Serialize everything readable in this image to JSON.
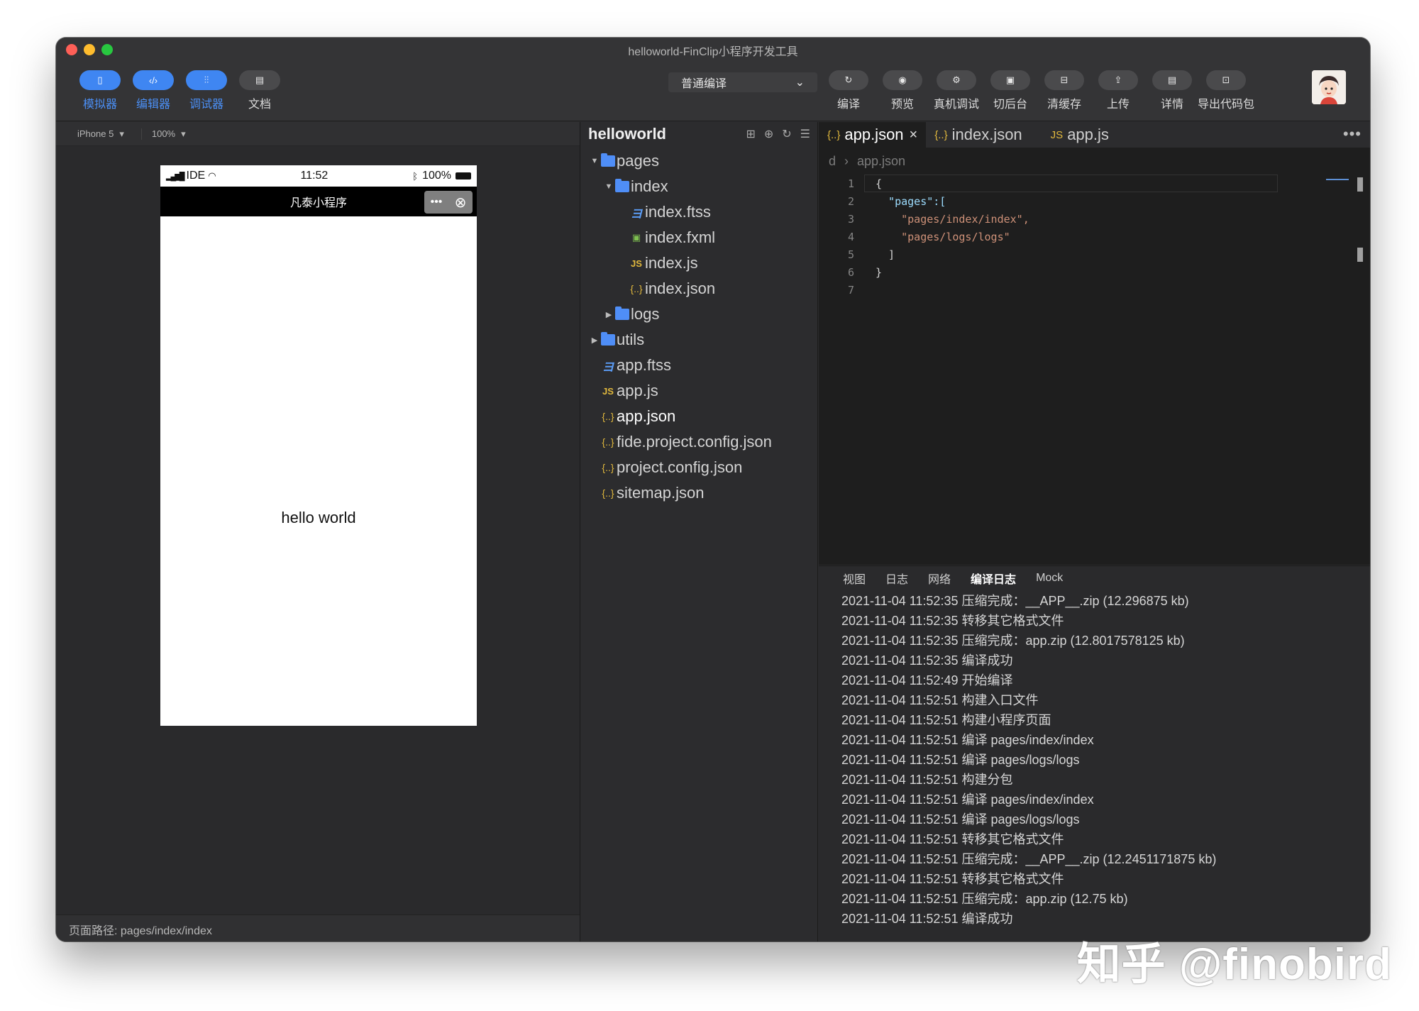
{
  "window": {
    "title": "helloworld-FinClip小程序开发工具"
  },
  "toolbar": {
    "left": [
      {
        "icon": "phone-icon",
        "glyph": "▯",
        "label": "模拟器",
        "active": true
      },
      {
        "icon": "code-icon",
        "glyph": "‹/›",
        "label": "编辑器",
        "active": true
      },
      {
        "icon": "sliders-icon",
        "glyph": "⫶⫶",
        "label": "调试器",
        "active": true
      },
      {
        "icon": "document-icon",
        "glyph": "▤",
        "label": "文档",
        "active": false
      }
    ],
    "compile_mode": "普通编译",
    "right": [
      {
        "icon": "refresh-icon",
        "glyph": "↻",
        "label": "编译"
      },
      {
        "icon": "eye-icon",
        "glyph": "◉",
        "label": "预览"
      },
      {
        "icon": "device-debug-icon",
        "glyph": "⚙",
        "label": "真机调试"
      },
      {
        "icon": "background-icon",
        "glyph": "▣",
        "label": "切后台"
      },
      {
        "icon": "clear-cache-icon",
        "glyph": "⊟",
        "label": "清缓存"
      },
      {
        "icon": "upload-icon",
        "glyph": "⇪",
        "label": "上传"
      },
      {
        "icon": "details-icon",
        "glyph": "▤",
        "label": "详情"
      },
      {
        "icon": "folder-export-icon",
        "glyph": "⊡",
        "label": "导出代码包"
      }
    ]
  },
  "simulator": {
    "device": "iPhone 5",
    "zoom": "100%",
    "status": {
      "carrier": "IDE",
      "time": "11:52",
      "battery": "100%"
    },
    "nav_title": "凡泰小程序",
    "capsule_more": "•••",
    "capsule_close": "⊗",
    "content": "hello world",
    "footer_path": "页面路径: pages/index/index"
  },
  "tree": {
    "title": "helloworld",
    "items": [
      {
        "name": "pages",
        "type": "folder",
        "depth": 0,
        "expanded": true
      },
      {
        "name": "index",
        "type": "folder",
        "depth": 1,
        "expanded": true
      },
      {
        "name": "index.ftss",
        "type": "ftss",
        "depth": 2
      },
      {
        "name": "index.fxml",
        "type": "fxml",
        "depth": 2
      },
      {
        "name": "index.js",
        "type": "js",
        "depth": 2
      },
      {
        "name": "index.json",
        "type": "json",
        "depth": 2
      },
      {
        "name": "logs",
        "type": "folder",
        "depth": 1,
        "expanded": false
      },
      {
        "name": "utils",
        "type": "folder",
        "depth": 0,
        "expanded": false
      },
      {
        "name": "app.ftss",
        "type": "ftss",
        "depth": 0
      },
      {
        "name": "app.js",
        "type": "js",
        "depth": 0
      },
      {
        "name": "app.json",
        "type": "json",
        "depth": 0,
        "selected": true
      },
      {
        "name": "fide.project.config.json",
        "type": "json",
        "depth": 0
      },
      {
        "name": "project.config.json",
        "type": "json",
        "depth": 0
      },
      {
        "name": "sitemap.json",
        "type": "json",
        "depth": 0
      }
    ]
  },
  "editor": {
    "tabs": [
      {
        "label": "app.json",
        "icon": "{..}",
        "active": true,
        "closable": true
      },
      {
        "label": "index.json",
        "icon": "{..}",
        "active": false
      },
      {
        "label": "app.js",
        "icon": "JS",
        "active": false
      }
    ],
    "more": "•••",
    "breadcrumb": [
      "d",
      "app.json"
    ],
    "lines": [
      {
        "n": "1",
        "text": "{"
      },
      {
        "n": "2",
        "text": "  \"pages\":["
      },
      {
        "n": "3",
        "text": "    \"pages/index/index\","
      },
      {
        "n": "4",
        "text": "    \"pages/logs/logs\""
      },
      {
        "n": "5",
        "text": "  ]"
      },
      {
        "n": "6",
        "text": "}"
      },
      {
        "n": "7",
        "text": ""
      }
    ]
  },
  "console": {
    "tabs": [
      {
        "label": "视图",
        "active": false
      },
      {
        "label": "日志",
        "active": false
      },
      {
        "label": "网络",
        "active": false
      },
      {
        "label": "编译日志",
        "active": true
      },
      {
        "label": "Mock",
        "active": false
      }
    ],
    "logs": [
      "2021-11-04 11:52:35 压缩完成：__APP__.zip (12.296875 kb)",
      "2021-11-04 11:52:35 转移其它格式文件",
      "2021-11-04 11:52:35 压缩完成：app.zip (12.8017578125 kb)",
      "2021-11-04 11:52:35 编译成功",
      "2021-11-04 11:52:49 开始编译",
      "2021-11-04 11:52:51 构建入口文件",
      "2021-11-04 11:52:51 构建小程序页面",
      "2021-11-04 11:52:51 编译 pages/index/index",
      "2021-11-04 11:52:51 编译 pages/logs/logs",
      "2021-11-04 11:52:51 构建分包",
      "2021-11-04 11:52:51 编译 pages/index/index",
      "2021-11-04 11:52:51 编译 pages/logs/logs",
      "2021-11-04 11:52:51 转移其它格式文件",
      "2021-11-04 11:52:51 压缩完成：__APP__.zip (12.2451171875 kb)",
      "2021-11-04 11:52:51 转移其它格式文件",
      "2021-11-04 11:52:51 压缩完成：app.zip (12.75 kb)",
      "2021-11-04 11:52:51 编译成功"
    ]
  },
  "watermark": "知乎 @finobird",
  "colors": {
    "accent": "#3f86f2",
    "folder": "#4f8ef7",
    "json": "#e2b93d"
  }
}
